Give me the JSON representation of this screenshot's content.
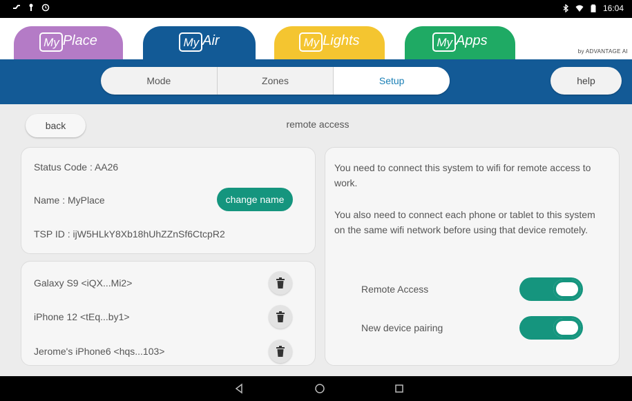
{
  "status_bar": {
    "time": "16:04"
  },
  "app_tabs": {
    "myplace": {
      "prefix": "My",
      "word": "Place"
    },
    "myair": {
      "prefix": "My",
      "word": "Air"
    },
    "mylights": {
      "prefix": "My",
      "word": "Lights"
    },
    "myapps": {
      "prefix": "My",
      "word": "Apps"
    },
    "brand": "by ADVANTAGE AI"
  },
  "nav": {
    "segments": [
      "Mode",
      "Zones",
      "Setup"
    ],
    "active": "Setup",
    "help_label": "help"
  },
  "page": {
    "back_label": "back",
    "title": "remote access"
  },
  "info": {
    "status_code": "Status Code : AA26",
    "name": "Name : MyPlace",
    "change_name_label": "change name",
    "tsp_id": "TSP ID : ijW5HLkY8Xb18hUhZZnSf6CtcpR2"
  },
  "devices": [
    {
      "label": "Galaxy S9 <iQX...Mi2>"
    },
    {
      "label": "iPhone 12 <tEq...by1>"
    },
    {
      "label": "Jerome's iPhone6 <hqs...103>"
    }
  ],
  "remote": {
    "paragraph1": "You need to connect this system to wifi for remote access to work.",
    "paragraph2": "You also need to connect each phone or tablet to this system on the same wifi network before using that device remotely.",
    "toggles": [
      {
        "label": "Remote Access",
        "on": true
      },
      {
        "label": "New device pairing",
        "on": true
      }
    ]
  },
  "colors": {
    "navbar": "#135a96",
    "accent_green": "#15957e",
    "myplace": "#b47bc6",
    "myair": "#125a96",
    "mylights": "#f4c530",
    "myapps": "#1faa64"
  },
  "icons": [
    "signal-icon",
    "usb-icon",
    "alarm-icon",
    "bluetooth-icon",
    "wifi-icon",
    "battery-icon",
    "trash-icon",
    "back-nav-icon",
    "home-nav-icon",
    "recents-nav-icon"
  ]
}
